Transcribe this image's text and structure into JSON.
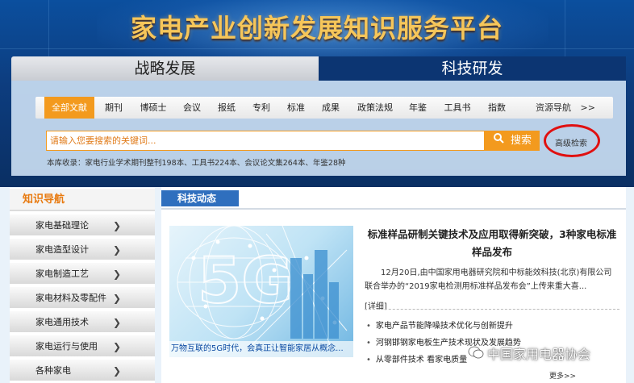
{
  "header": {
    "site_title": "家电产业创新发展知识服务平台",
    "tab_left": "战略发展",
    "tab_right": "科技研发"
  },
  "categories": [
    "全部文献",
    "期刊",
    "博硕士",
    "会议",
    "报纸",
    "专利",
    "标准",
    "成果",
    "政策法规",
    "年鉴",
    "工具书",
    "指数"
  ],
  "categories_more": "资源导航",
  "categories_more_arrow": ">>",
  "search": {
    "placeholder": "请输入您要搜索的关键词...",
    "button_label": "搜索",
    "advanced_label": "高级检索"
  },
  "stats_text": "本库收录：家电行业学术期刊整刊198本、工具书224本、会议论文集264本、年鉴28种",
  "sidebar": {
    "title": "知识导航",
    "items": [
      "家电基础理论",
      "家电造型设计",
      "家电制造工艺",
      "家电材料及零配件",
      "家电通用技术",
      "家电运行与使用",
      "各种家电"
    ]
  },
  "news": {
    "section_title": "科技动态",
    "image_caption": "万物互联的5G时代，会真正让智能家居从概念...",
    "article_title": "标准样品研制关键技术及应用取得新突破，3种家电标准样品发布",
    "article_body": "12月20日,由中国家用电器研究院和中标能效科技(北京)有限公司联合举办的“2019家电检测用标准样品发布会”上传来重大喜...",
    "detail_label": "[详细]",
    "bullets": [
      "家电产品节能降噪技术优化与创新提升",
      "河钢邯钢家电板生产技术现状及发展趋势",
      "从零部件技术 看家电质量"
    ],
    "more_label": "更多>>"
  },
  "watermark": "中国家用电器协会",
  "colors": {
    "accent_orange": "#f39a1e",
    "header_blue": "#0c3572",
    "title_gold": "#f6c65a",
    "annotation_red": "#e01010"
  }
}
